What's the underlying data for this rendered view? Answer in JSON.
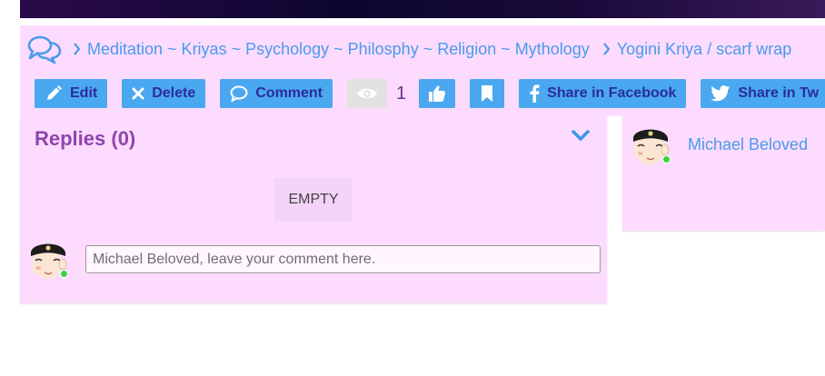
{
  "breadcrumb": {
    "forum_icon": "forum-icon",
    "items": [
      {
        "label": "Meditation ~ Kriyas ~ Psychology ~ Philosphy ~ Religion ~ Mythology"
      },
      {
        "label": "Yogini Kriya / scarf wrap"
      }
    ]
  },
  "toolbar": {
    "edit_label": "Edit",
    "delete_label": "Delete",
    "comment_label": "Comment",
    "view_count": "1",
    "share_facebook_label": "Share in Facebook",
    "share_twitter_label": "Share in Tw"
  },
  "replies": {
    "title": "Replies (0)",
    "empty_label": "EMPTY",
    "comment_placeholder": "Michael Beloved, leave your comment here."
  },
  "author": {
    "name": "Michael Beloved",
    "online": true
  },
  "colors": {
    "panel": "#fddbff",
    "button": "#4aa8f0",
    "button_text": "#2b2c9c",
    "link": "#4a9be8",
    "title": "#8e44ad",
    "online": "#40d040"
  }
}
